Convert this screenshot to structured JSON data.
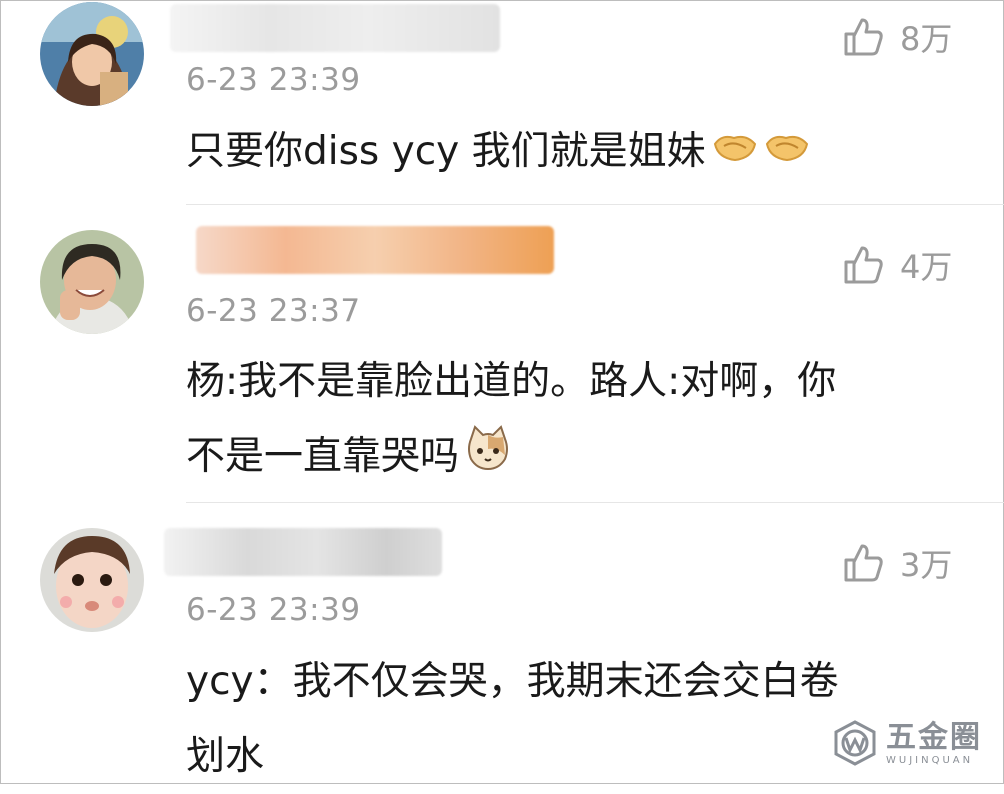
{
  "comments": [
    {
      "time": "6-23 23:39",
      "likes": "8万",
      "text": "只要你diss ycy 我们就是姐妹",
      "emoji": [
        "handshake-icon",
        "handshake-icon"
      ]
    },
    {
      "time": "6-23 23:37",
      "likes": "4万",
      "text": "杨:我不是靠脸出道的。路人:对啊，你\n不是一直靠哭吗",
      "emoji": [
        "cat-face-icon"
      ]
    },
    {
      "time": "6-23 23:39",
      "likes": "3万",
      "text": "ycy：我不仅会哭，我期末还会交白卷\n划水",
      "emoji": []
    }
  ],
  "watermark": {
    "cn": "五金圈",
    "en": "WUJINQUAN"
  },
  "colors": {
    "meta_gray": "#9b9b9b",
    "text": "#1a1a1a",
    "divider": "#e6e6e6"
  }
}
